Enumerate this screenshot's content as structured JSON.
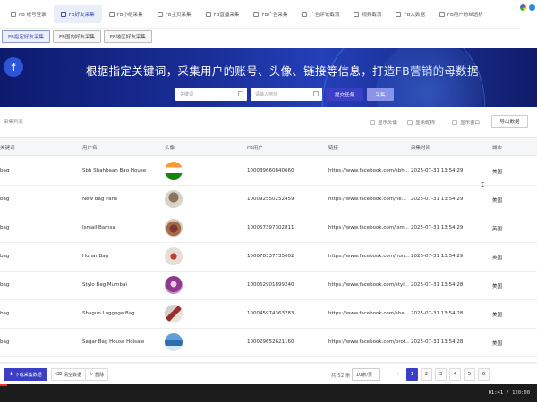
{
  "top_tabs": [
    {
      "label": "FB 帐号登录",
      "active": false
    },
    {
      "label": "FB好友采集",
      "active": true
    },
    {
      "label": "FB小组采集",
      "active": false
    },
    {
      "label": "FB主页采集",
      "active": false
    },
    {
      "label": "FB直播采集",
      "active": false
    },
    {
      "label": "FB广告采集",
      "active": false
    },
    {
      "label": "广告评论截流",
      "active": false
    },
    {
      "label": "视频截流",
      "active": false
    },
    {
      "label": "FB大数据",
      "active": false
    },
    {
      "label": "FB用户粉丝透析",
      "active": false
    }
  ],
  "sub_tabs": [
    {
      "label": "FB指定好友采集",
      "active": true
    },
    {
      "label": "FB国内好友采集",
      "active": false
    },
    {
      "label": "FB地区好友采集",
      "active": false
    }
  ],
  "banner": {
    "logo": "f",
    "headline": "根据指定关键词，采集用户的账号、头像、链接等信息，打造FB营销的母数据",
    "keyword_placeholder": "关键词",
    "url_placeholder": "请输入地址",
    "submit_label": "提交任务",
    "other_label": "采集"
  },
  "toolbar": {
    "list_label": "采集列表",
    "checkboxes": [
      "显示头像",
      "显示昵称",
      "显示窗口"
    ],
    "export_label": "导出数据"
  },
  "table": {
    "headers": [
      "关键词",
      "用户名",
      "头像",
      "FB用户",
      "链接",
      "采集时间",
      "城市"
    ],
    "rows": [
      {
        "keyword": "bag",
        "user": "Sbh Shahbaan Bag House",
        "fbid": "100039660840660",
        "link": "https://www.facebook.com/sbh...",
        "time": "2025-07-31 13:54:29",
        "city": "美国",
        "avatar": "a1"
      },
      {
        "keyword": "bag",
        "user": "New Bag Paris",
        "fbid": "100092550252459",
        "link": "https://www.facebook.com/ne...",
        "time": "2025-07-31 13:54:29",
        "city": "美国",
        "avatar": "a2"
      },
      {
        "keyword": "bag",
        "user": "Ismail Bamsa",
        "fbid": "100057397302811",
        "link": "https://www.facebook.com/ism...",
        "time": "2025-07-31 13:54:29",
        "city": "英国",
        "avatar": "a3"
      },
      {
        "keyword": "bag",
        "user": "Hunar Bag",
        "fbid": "100078337735602",
        "link": "https://www.facebook.com/hun...",
        "time": "2025-07-31 13:54:29",
        "city": "英国",
        "avatar": "a4"
      },
      {
        "keyword": "bag",
        "user": "Stylo Bag Mumbai",
        "fbid": "100062901899240",
        "link": "https://www.facebook.com/styl...",
        "time": "2025-07-31 13:54:28",
        "city": "美国",
        "avatar": "a5"
      },
      {
        "keyword": "bag",
        "user": "Shagun Luggage Bag",
        "fbid": "100045974363783",
        "link": "https://www.facebook.com/sha...",
        "time": "2025-07-31 13:54:28",
        "city": "美国",
        "avatar": "a6"
      },
      {
        "keyword": "bag",
        "user": "Sagar Bag House Holsale",
        "fbid": "100029652621160",
        "link": "https://www.facebook.com/prof...",
        "time": "2025-07-31 13:54:28",
        "city": "美国",
        "avatar": "a7"
      }
    ]
  },
  "footer": {
    "download_label": "下载采集数据",
    "clear_label": "清空数据",
    "delete_label": "删除",
    "total": "共 52 条",
    "page_size": "10条/页",
    "pages": [
      "1",
      "2",
      "3",
      "4",
      "5",
      "6"
    ],
    "current_page": "1",
    "prev": "‹",
    "next": "›"
  },
  "video": {
    "current": "01:41",
    "total": "/ 120:00",
    "progress": 0.014
  },
  "colors": {
    "accent": "#3a3fc6",
    "banner": "#1a2f9a"
  }
}
